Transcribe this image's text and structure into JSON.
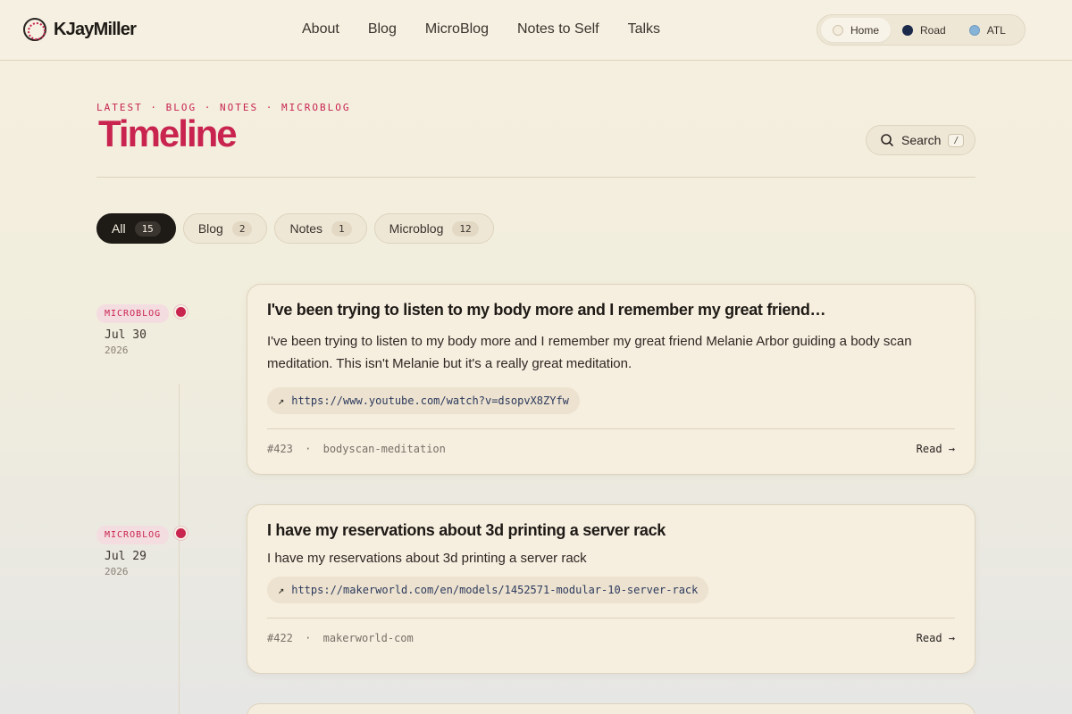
{
  "header": {
    "brand": "KJayMiller",
    "nav": [
      "About",
      "Blog",
      "MicroBlog",
      "Notes to Self",
      "Talks"
    ],
    "modes": [
      {
        "label": "Home",
        "color": "#f4ecdd",
        "active": true
      },
      {
        "label": "Road",
        "color": "#1b2a4a",
        "active": false
      },
      {
        "label": "ATL",
        "color": "#86b3d6",
        "active": false
      }
    ]
  },
  "page": {
    "kicker": "LATEST · BLOG · NOTES · MICROBLOG",
    "title": "Timeline",
    "search_label": "Search",
    "search_shortcut": "/"
  },
  "filters": [
    {
      "label": "All",
      "count": "15",
      "active": true
    },
    {
      "label": "Blog",
      "count": "2",
      "active": false
    },
    {
      "label": "Notes",
      "count": "1",
      "active": false
    },
    {
      "label": "Microblog",
      "count": "12",
      "active": false
    }
  ],
  "entries": [
    {
      "type": "MICROBLOG",
      "date": "Jul 30",
      "year": "2026",
      "title": "I've been trying to listen to my body more and I remember my great friend…",
      "body": "I've been trying to listen to my body more and I remember my great friend Melanie Arbor guiding a body scan meditation. This isn't Melanie but it's a really great meditation.",
      "link": "https://www.youtube.com/watch?v=dsopvX8ZYfw",
      "id": "#423",
      "slug": "bodyscan-meditation",
      "read": "Read →"
    },
    {
      "type": "MICROBLOG",
      "date": "Jul 29",
      "year": "2026",
      "title": "I have my reservations about 3d printing a server rack",
      "body": "I have my reservations about 3d printing a server rack",
      "link": "https://makerworld.com/en/models/1452571-modular-10-server-rack",
      "id": "#422",
      "slug": "makerworld-com",
      "read": "Read →"
    }
  ],
  "separator": "·",
  "icons": {
    "search": "search-icon",
    "link": "arrow-up-right-icon"
  },
  "colors": {
    "accent": "#c8244f",
    "ink": "#1e1a16"
  }
}
